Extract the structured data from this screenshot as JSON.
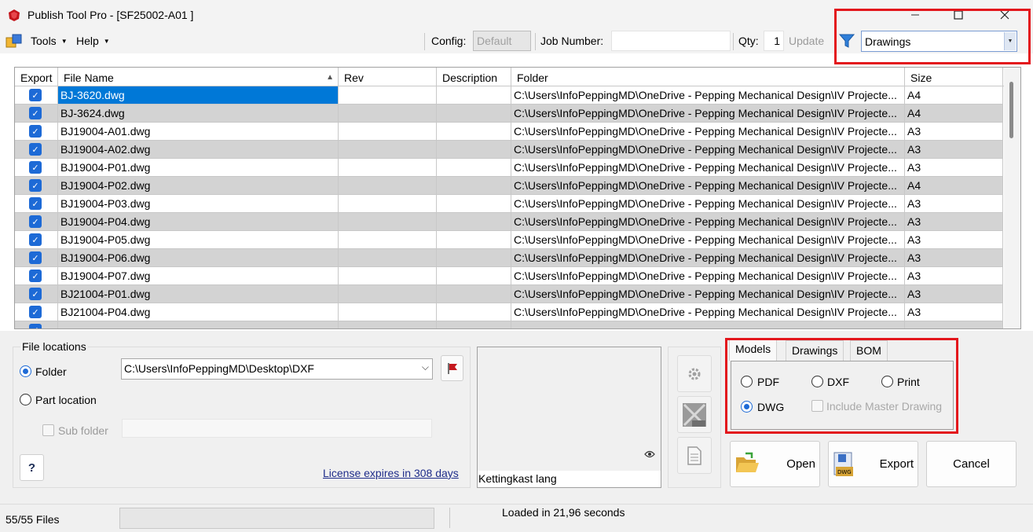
{
  "window": {
    "title": "Publish Tool Pro - [SF25002-A01 ]"
  },
  "menu": {
    "tools": "Tools",
    "help": "Help"
  },
  "toolbar": {
    "config_label": "Config:",
    "config_value": "Default",
    "job_number_label": "Job Number:",
    "job_number_value": "",
    "qty_label": "Qty:",
    "qty_value": "1",
    "update_label": "Update",
    "filter_value": "Drawings"
  },
  "grid": {
    "columns": [
      "Export",
      "File Name",
      "Rev",
      "Description",
      "Folder",
      "Size"
    ],
    "rows": [
      {
        "file": "BJ-3620.dwg",
        "rev": "",
        "desc": "",
        "folder": "C:\\Users\\InfoPeppingMD\\OneDrive - Pepping Mechanical Design\\IV Projecte...",
        "size": "A4",
        "selected": true
      },
      {
        "file": "BJ-3624.dwg",
        "rev": "",
        "desc": "",
        "folder": "C:\\Users\\InfoPeppingMD\\OneDrive - Pepping Mechanical Design\\IV Projecte...",
        "size": "A4"
      },
      {
        "file": "BJ19004-A01.dwg",
        "rev": "",
        "desc": "",
        "folder": "C:\\Users\\InfoPeppingMD\\OneDrive - Pepping Mechanical Design\\IV Projecte...",
        "size": "A3"
      },
      {
        "file": "BJ19004-A02.dwg",
        "rev": "",
        "desc": "",
        "folder": "C:\\Users\\InfoPeppingMD\\OneDrive - Pepping Mechanical Design\\IV Projecte...",
        "size": "A3"
      },
      {
        "file": "BJ19004-P01.dwg",
        "rev": "",
        "desc": "",
        "folder": "C:\\Users\\InfoPeppingMD\\OneDrive - Pepping Mechanical Design\\IV Projecte...",
        "size": "A3"
      },
      {
        "file": "BJ19004-P02.dwg",
        "rev": "",
        "desc": "",
        "folder": "C:\\Users\\InfoPeppingMD\\OneDrive - Pepping Mechanical Design\\IV Projecte...",
        "size": "A4"
      },
      {
        "file": "BJ19004-P03.dwg",
        "rev": "",
        "desc": "",
        "folder": "C:\\Users\\InfoPeppingMD\\OneDrive - Pepping Mechanical Design\\IV Projecte...",
        "size": "A3"
      },
      {
        "file": "BJ19004-P04.dwg",
        "rev": "",
        "desc": "",
        "folder": "C:\\Users\\InfoPeppingMD\\OneDrive - Pepping Mechanical Design\\IV Projecte...",
        "size": "A3"
      },
      {
        "file": "BJ19004-P05.dwg",
        "rev": "",
        "desc": "",
        "folder": "C:\\Users\\InfoPeppingMD\\OneDrive - Pepping Mechanical Design\\IV Projecte...",
        "size": "A3"
      },
      {
        "file": "BJ19004-P06.dwg",
        "rev": "",
        "desc": "",
        "folder": "C:\\Users\\InfoPeppingMD\\OneDrive - Pepping Mechanical Design\\IV Projecte...",
        "size": "A3"
      },
      {
        "file": "BJ19004-P07.dwg",
        "rev": "",
        "desc": "",
        "folder": "C:\\Users\\InfoPeppingMD\\OneDrive - Pepping Mechanical Design\\IV Projecte...",
        "size": "A3"
      },
      {
        "file": "BJ21004-P01.dwg",
        "rev": "",
        "desc": "",
        "folder": "C:\\Users\\InfoPeppingMD\\OneDrive - Pepping Mechanical Design\\IV Projecte...",
        "size": "A3"
      },
      {
        "file": "BJ21004-P04.dwg",
        "rev": "",
        "desc": "",
        "folder": "C:\\Users\\InfoPeppingMD\\OneDrive - Pepping Mechanical Design\\IV Projecte...",
        "size": "A3"
      }
    ]
  },
  "file_locations": {
    "title": "File locations",
    "folder_label": "Folder",
    "folder_path": "C:\\Users\\InfoPeppingMD\\Desktop\\DXF",
    "part_location_label": "Part location",
    "sub_folder_label": "Sub folder",
    "help_label": "?",
    "license_text": "License expires in 308 days"
  },
  "preview": {
    "label": "Kettingkast lang"
  },
  "tabs": {
    "items": [
      "Models",
      "Drawings",
      "BOM"
    ],
    "options": {
      "pdf": "PDF",
      "dxf": "DXF",
      "print": "Print",
      "dwg": "DWG",
      "include_master": "Include Master Drawing"
    }
  },
  "buttons": {
    "open": "Open",
    "export": "Export",
    "cancel": "Cancel"
  },
  "status": {
    "count": "55/55 Files",
    "message": "Loaded in 21,96 seconds"
  },
  "colors": {
    "accent": "#0078d7",
    "highlight_box": "#e3161c",
    "row_alt": "#d3d3d3"
  }
}
